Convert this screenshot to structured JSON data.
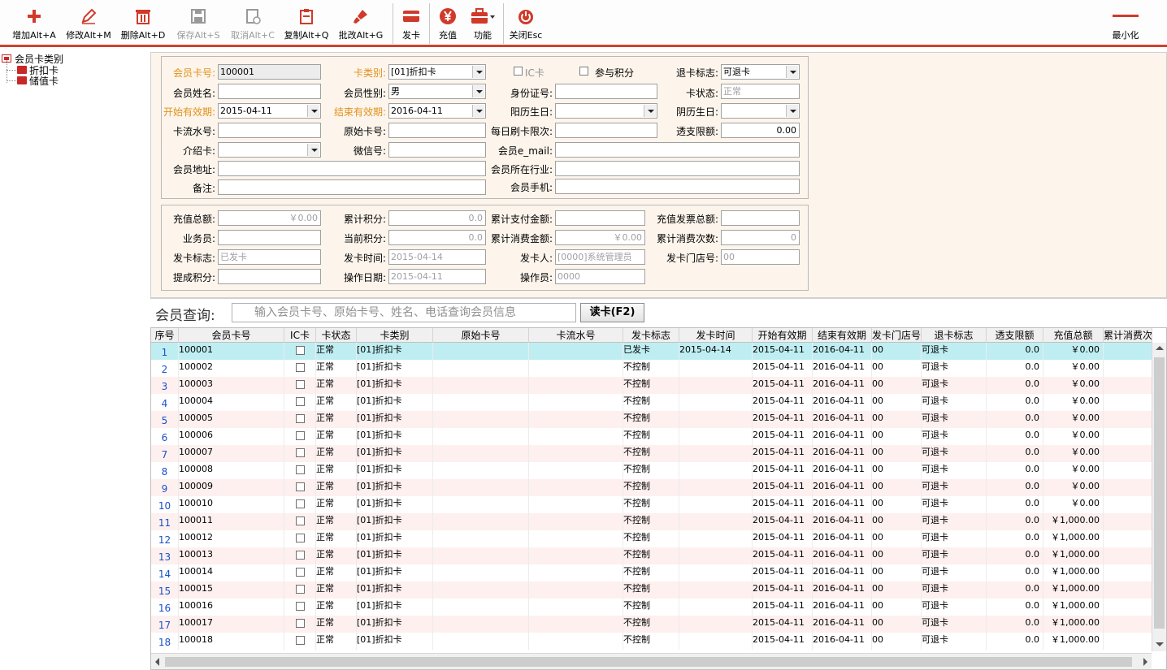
{
  "toolbar": {
    "add": "增加Alt+A",
    "edit": "修改Alt+M",
    "delete": "删除Alt+D",
    "save": "保存Alt+S",
    "cancel": "取消Alt+C",
    "copy": "复制Alt+Q",
    "batch_edit": "批改Alt+G",
    "issue_card": "发卡",
    "recharge": "充值",
    "functions": "功能",
    "close": "关闭Esc",
    "minimize": "最小化"
  },
  "tree": {
    "root": "会员卡类别",
    "items": [
      "折扣卡",
      "储值卡"
    ]
  },
  "form": {
    "card_no_label": "会员卡号:",
    "card_no": "100001",
    "card_type_label": "卡类别:",
    "card_type": "[01]折扣卡",
    "ic_card_label": "IC卡",
    "points_label": "参与积分",
    "refund_flag_label": "退卡标志:",
    "refund_flag": "可退卡",
    "name_label": "会员姓名:",
    "name": "",
    "gender_label": "会员性别:",
    "gender": "男",
    "id_no_label": "身份证号:",
    "id_no": "",
    "card_status_label": "卡状态:",
    "card_status": "正常",
    "start_date_label": "开始有效期:",
    "start_date": "2015-04-11",
    "end_date_label": "结束有效期:",
    "end_date": "2016-04-11",
    "solar_bday_label": "阳历生日:",
    "solar_bday": "",
    "lunar_bday_label": "阴历生日:",
    "lunar_bday": "",
    "flow_no_label": "卡流水号:",
    "flow_no": "",
    "orig_card_label": "原始卡号:",
    "orig_card": "",
    "daily_limit_label": "每日刷卡限次:",
    "daily_limit": "",
    "overdraft_label": "透支限额:",
    "overdraft": "0.00",
    "referrer_label": "介绍卡:",
    "referrer": "",
    "wechat_label": "微信号:",
    "wechat": "",
    "email_label": "会员e_mail:",
    "email": "",
    "address_label": "会员地址:",
    "address": "",
    "industry_label": "会员所在行业:",
    "industry": "",
    "remark_label": "备注:",
    "remark": "",
    "mobile_label": "会员手机:",
    "mobile": ""
  },
  "stats": {
    "recharge_total_label": "充值总额:",
    "recharge_total": "￥0.00",
    "cum_points_label": "累计积分:",
    "cum_points": "0.0",
    "cum_paid_label": "累计支付金额:",
    "cum_paid": "",
    "invoice_total_label": "充值发票总额:",
    "invoice_total": "",
    "salesman_label": "业务员:",
    "salesman": "",
    "cur_points_label": "当前积分:",
    "cur_points": "0.0",
    "cum_consume_label": "累计消费金额:",
    "cum_consume": "￥0.00",
    "consume_count_label": "累计消费次数:",
    "consume_count": "0",
    "issue_flag_label": "发卡标志:",
    "issue_flag": "已发卡",
    "issue_time_label": "发卡时间:",
    "issue_time": "2015-04-14",
    "issuer_label": "发卡人:",
    "issuer": "[0000]系统管理员",
    "issue_store_label": "发卡门店号:",
    "issue_store": "00",
    "commission_label": "提成积分:",
    "commission": "",
    "op_date_label": "操作日期:",
    "op_date": "2015-04-11",
    "operator_label": "操作员:",
    "operator": "0000"
  },
  "search": {
    "label": "会员查询:",
    "placeholder": "输入会员卡号、原始卡号、姓名、电话查询会员信息",
    "button": "读卡(F2)"
  },
  "grid": {
    "columns": [
      "序号",
      "会员卡号",
      "IC卡",
      "卡状态",
      "卡类别",
      "原始卡号",
      "卡流水号",
      "发卡标志",
      "发卡时间",
      "开始有效期",
      "结束有效期",
      "发卡门店号",
      "退卡标志",
      "透支限额",
      "充值总额",
      "累计消费次"
    ],
    "rows": [
      {
        "no": "1",
        "card": "100001",
        "status": "正常",
        "type": "[01]折扣卡",
        "orig": "",
        "flow": "",
        "flag": "已发卡",
        "time": "2015-04-14",
        "start": "2015-04-11",
        "end": "2016-04-11",
        "store": "00",
        "refund": "可退卡",
        "limit": "0.0",
        "total": "￥0.00"
      },
      {
        "no": "2",
        "card": "100002",
        "status": "正常",
        "type": "[01]折扣卡",
        "orig": "",
        "flow": "",
        "flag": "不控制",
        "time": "",
        "start": "2015-04-11",
        "end": "2016-04-11",
        "store": "00",
        "refund": "可退卡",
        "limit": "0.0",
        "total": "￥0.00"
      },
      {
        "no": "3",
        "card": "100003",
        "status": "正常",
        "type": "[01]折扣卡",
        "orig": "",
        "flow": "",
        "flag": "不控制",
        "time": "",
        "start": "2015-04-11",
        "end": "2016-04-11",
        "store": "00",
        "refund": "可退卡",
        "limit": "0.0",
        "total": "￥0.00"
      },
      {
        "no": "4",
        "card": "100004",
        "status": "正常",
        "type": "[01]折扣卡",
        "orig": "",
        "flow": "",
        "flag": "不控制",
        "time": "",
        "start": "2015-04-11",
        "end": "2016-04-11",
        "store": "00",
        "refund": "可退卡",
        "limit": "0.0",
        "total": "￥0.00"
      },
      {
        "no": "5",
        "card": "100005",
        "status": "正常",
        "type": "[01]折扣卡",
        "orig": "",
        "flow": "",
        "flag": "不控制",
        "time": "",
        "start": "2015-04-11",
        "end": "2016-04-11",
        "store": "00",
        "refund": "可退卡",
        "limit": "0.0",
        "total": "￥0.00"
      },
      {
        "no": "6",
        "card": "100006",
        "status": "正常",
        "type": "[01]折扣卡",
        "orig": "",
        "flow": "",
        "flag": "不控制",
        "time": "",
        "start": "2015-04-11",
        "end": "2016-04-11",
        "store": "00",
        "refund": "可退卡",
        "limit": "0.0",
        "total": "￥0.00"
      },
      {
        "no": "7",
        "card": "100007",
        "status": "正常",
        "type": "[01]折扣卡",
        "orig": "",
        "flow": "",
        "flag": "不控制",
        "time": "",
        "start": "2015-04-11",
        "end": "2016-04-11",
        "store": "00",
        "refund": "可退卡",
        "limit": "0.0",
        "total": "￥0.00"
      },
      {
        "no": "8",
        "card": "100008",
        "status": "正常",
        "type": "[01]折扣卡",
        "orig": "",
        "flow": "",
        "flag": "不控制",
        "time": "",
        "start": "2015-04-11",
        "end": "2016-04-11",
        "store": "00",
        "refund": "可退卡",
        "limit": "0.0",
        "total": "￥0.00"
      },
      {
        "no": "9",
        "card": "100009",
        "status": "正常",
        "type": "[01]折扣卡",
        "orig": "",
        "flow": "",
        "flag": "不控制",
        "time": "",
        "start": "2015-04-11",
        "end": "2016-04-11",
        "store": "00",
        "refund": "可退卡",
        "limit": "0.0",
        "total": "￥0.00"
      },
      {
        "no": "10",
        "card": "100010",
        "status": "正常",
        "type": "[01]折扣卡",
        "orig": "",
        "flow": "",
        "flag": "不控制",
        "time": "",
        "start": "2015-04-11",
        "end": "2016-04-11",
        "store": "00",
        "refund": "可退卡",
        "limit": "0.0",
        "total": "￥0.00"
      },
      {
        "no": "11",
        "card": "100011",
        "status": "正常",
        "type": "[01]折扣卡",
        "orig": "",
        "flow": "",
        "flag": "不控制",
        "time": "",
        "start": "2015-04-11",
        "end": "2016-04-11",
        "store": "00",
        "refund": "可退卡",
        "limit": "0.0",
        "total": "￥1,000.00"
      },
      {
        "no": "12",
        "card": "100012",
        "status": "正常",
        "type": "[01]折扣卡",
        "orig": "",
        "flow": "",
        "flag": "不控制",
        "time": "",
        "start": "2015-04-11",
        "end": "2016-04-11",
        "store": "00",
        "refund": "可退卡",
        "limit": "0.0",
        "total": "￥1,000.00"
      },
      {
        "no": "13",
        "card": "100013",
        "status": "正常",
        "type": "[01]折扣卡",
        "orig": "",
        "flow": "",
        "flag": "不控制",
        "time": "",
        "start": "2015-04-11",
        "end": "2016-04-11",
        "store": "00",
        "refund": "可退卡",
        "limit": "0.0",
        "total": "￥1,000.00"
      },
      {
        "no": "14",
        "card": "100014",
        "status": "正常",
        "type": "[01]折扣卡",
        "orig": "",
        "flow": "",
        "flag": "不控制",
        "time": "",
        "start": "2015-04-11",
        "end": "2016-04-11",
        "store": "00",
        "refund": "可退卡",
        "limit": "0.0",
        "total": "￥1,000.00"
      },
      {
        "no": "15",
        "card": "100015",
        "status": "正常",
        "type": "[01]折扣卡",
        "orig": "",
        "flow": "",
        "flag": "不控制",
        "time": "",
        "start": "2015-04-11",
        "end": "2016-04-11",
        "store": "00",
        "refund": "可退卡",
        "limit": "0.0",
        "total": "￥1,000.00"
      },
      {
        "no": "16",
        "card": "100016",
        "status": "正常",
        "type": "[01]折扣卡",
        "orig": "",
        "flow": "",
        "flag": "不控制",
        "time": "",
        "start": "2015-04-11",
        "end": "2016-04-11",
        "store": "00",
        "refund": "可退卡",
        "limit": "0.0",
        "total": "￥1,000.00"
      },
      {
        "no": "17",
        "card": "100017",
        "status": "正常",
        "type": "[01]折扣卡",
        "orig": "",
        "flow": "",
        "flag": "不控制",
        "time": "",
        "start": "2015-04-11",
        "end": "2016-04-11",
        "store": "00",
        "refund": "可退卡",
        "limit": "0.0",
        "total": "￥1,000.00"
      },
      {
        "no": "18",
        "card": "100018",
        "status": "正常",
        "type": "[01]折扣卡",
        "orig": "",
        "flow": "",
        "flag": "不控制",
        "time": "",
        "start": "2015-04-11",
        "end": "2016-04-11",
        "store": "00",
        "refund": "可退卡",
        "limit": "0.0",
        "total": "￥1,000.00"
      }
    ]
  },
  "colors": {
    "accent_red": "#d04030",
    "required_label": "#e0911a",
    "form_bg": "#fdf5ec",
    "selected_row": "#bfeef2",
    "alt_row": "#fdf0ef",
    "row_number": "#1a52c8"
  },
  "icons": {
    "add": "plus-icon",
    "edit": "pencil-icon",
    "delete": "trash-icon",
    "save": "floppy-icon",
    "cancel": "cancel-doc-icon",
    "copy": "clipboard-icon",
    "batch_edit": "brush-icon",
    "issue_card": "card-icon",
    "recharge": "yen-coin-icon",
    "functions": "toolbox-icon",
    "close": "power-icon",
    "minimize": "minus-icon"
  }
}
